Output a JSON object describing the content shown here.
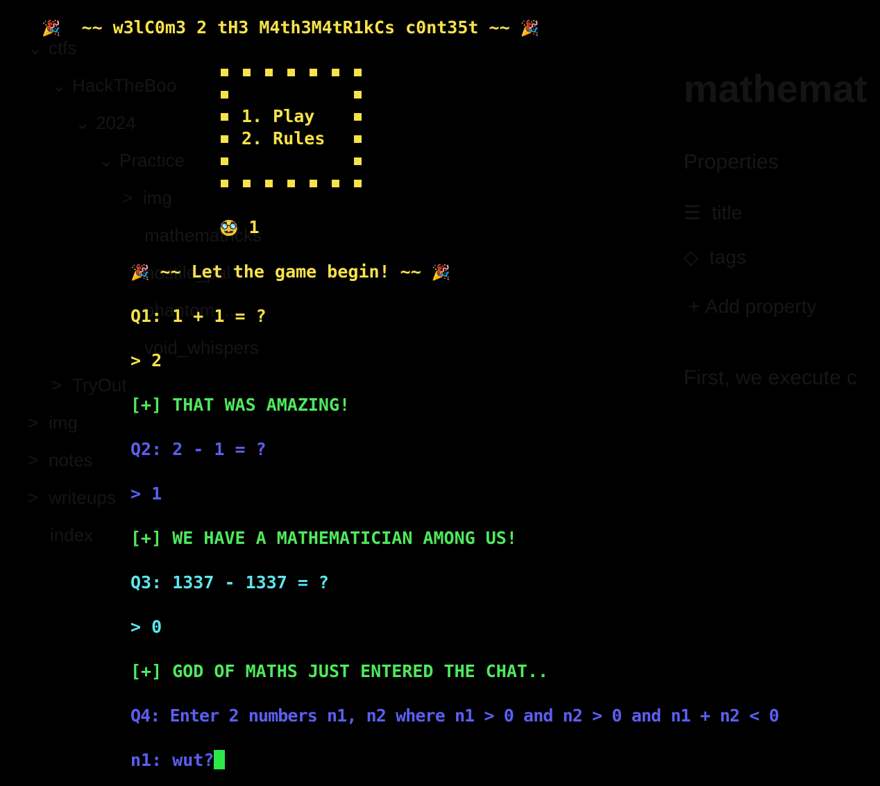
{
  "background_app": {
    "file_tree": [
      {
        "label": "ctfs",
        "chevron": "⌄"
      },
      {
        "label": "HackTheBoo",
        "chevron": "⌄"
      },
      {
        "label": "2024",
        "chevron": "⌄"
      },
      {
        "label": "Practice",
        "chevron": "⌄"
      },
      {
        "label": "img",
        "chevron": ">"
      },
      {
        "label": "mathematricks",
        "chevron": ""
      },
      {
        "label": "hostile_pal",
        "chevron": ""
      },
      {
        "label": "phantom_...",
        "chevron": ""
      },
      {
        "label": "void_whispers",
        "chevron": ""
      },
      {
        "label": "TryOut",
        "chevron": ">"
      },
      {
        "label": "img",
        "chevron": ">"
      },
      {
        "label": "notes",
        "chevron": ">"
      },
      {
        "label": "writeups",
        "chevron": ">"
      },
      {
        "label": "index",
        "chevron": ""
      }
    ],
    "note": {
      "title": "mathemat",
      "properties_heading": "Properties",
      "prop_title": "title",
      "prop_tags": "tags",
      "add_property": "Add property",
      "body_text": "First, we execute c"
    }
  },
  "terminal": {
    "banner": "~~ w3lC0m3 2 tH3 M4th3M4tR1kCs c0nt35t ~~",
    "banner_emoji": "🎉",
    "menu": {
      "option1": "1. Play",
      "option2": "2. Rules"
    },
    "choice_emoji": "🥸",
    "choice": "1",
    "start_message": "~~ Let the game begin! ~~",
    "q1": {
      "question": "Q1: 1 + 1 = ?",
      "answer": "> 2",
      "result": "[+] THAT WAS AMAZING!"
    },
    "q2": {
      "question": "Q2: 2 - 1 = ?",
      "answer": "> 1",
      "result": "[+] WE HAVE A MATHEMATICIAN AMONG US!"
    },
    "q3": {
      "question": "Q3: 1337 - 1337 = ?",
      "answer": "> 0",
      "result": "[+] GOD OF MATHS JUST ENTERED THE CHAT.."
    },
    "q4": {
      "question": "Q4: Enter 2 numbers n1, n2 where n1 > 0 and n2 > 0 and n1 + n2 < 0"
    },
    "input_prompt": "n1: wut?"
  },
  "colors": {
    "yellow": "#f7e24b",
    "green": "#4ee95c",
    "blue": "#5b5ff0",
    "cyan": "#5de6ee",
    "cursor": "#2ee84a"
  }
}
